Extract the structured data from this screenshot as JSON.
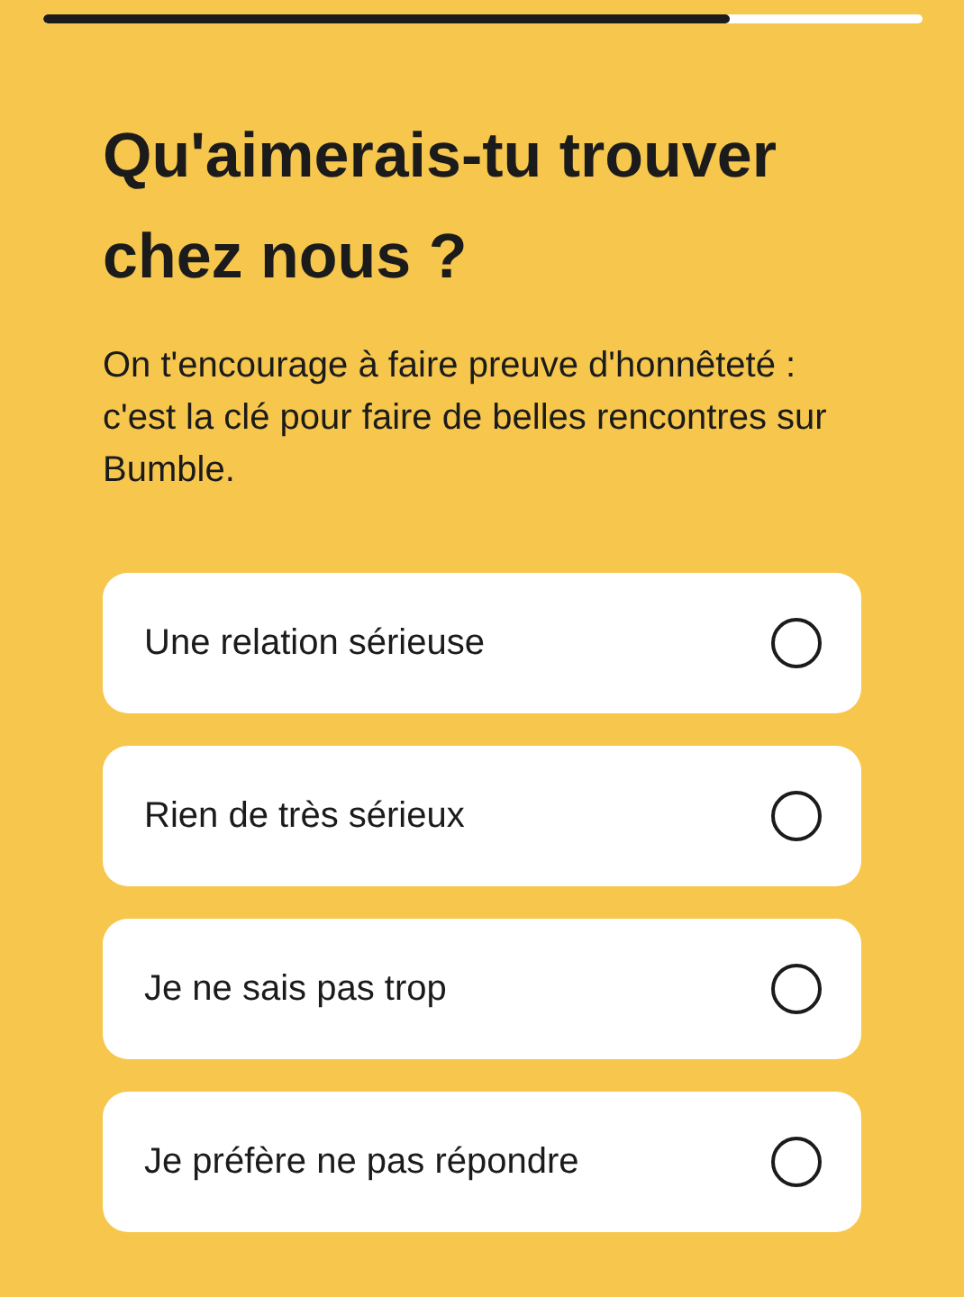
{
  "progress": {
    "level": 0.78
  },
  "title": "Qu'aimerais-tu trouver chez nous ?",
  "subtitle": "On t'encourage à faire preuve d'honnêteté : c'est la clé pour faire de belles rencontres sur Bumble.",
  "options": [
    {
      "label": "Une relation sérieuse",
      "selected": false
    },
    {
      "label": "Rien de très sérieux",
      "selected": false
    },
    {
      "label": "Je ne sais pas trop",
      "selected": false
    },
    {
      "label": "Je préfère ne pas répondre",
      "selected": false
    }
  ]
}
